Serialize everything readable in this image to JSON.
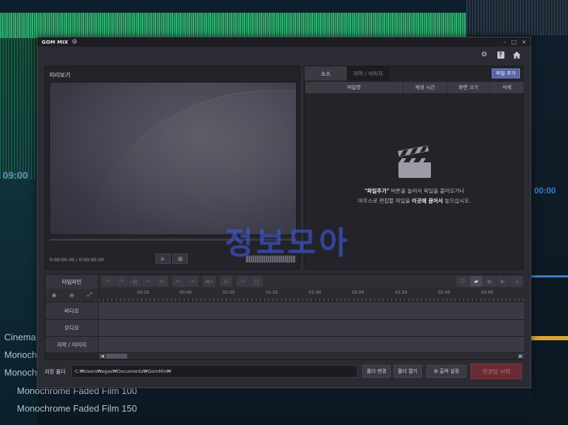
{
  "window": {
    "logo": "GOM MIX",
    "minimize": "–",
    "maximize": "□",
    "close": "×"
  },
  "preview": {
    "title": "미리보기",
    "time": "0:00:00.00 / 0:00:00.00"
  },
  "source": {
    "tabs": [
      "소스",
      "자막 / 이미지"
    ],
    "add_button": "파일 추가",
    "columns": [
      "파일명",
      "재생 시간",
      "화면 크기",
      "삭제"
    ],
    "empty_line1_bold": "\"파일추가\"",
    "empty_line1_rest": " 버튼을 눌러서 파일을 불러오거나",
    "empty_line2_pre": "마우스로 편집할 파일을 ",
    "empty_line2_bold": "이곳에 끌어서",
    "empty_line2_post": " 놓으십시오."
  },
  "timeline": {
    "label": "타임라인",
    "ticks": [
      "00:20",
      "00:40",
      "01:00",
      "01:20",
      "01:40",
      "02:00",
      "02:20",
      "02:40",
      "03:00"
    ],
    "tracks": [
      "비디오",
      "오디오",
      "자막 / 이미지"
    ]
  },
  "bottom": {
    "save_folder_label": "저장 폴더",
    "save_path": "C:₩Users₩egas₩Documents₩GomMix₩",
    "change_folder": "폴더 변경",
    "open_folder": "폴더 열기",
    "output_settings": "출력 설정",
    "start_encoding": "인코딩 시작"
  },
  "watermark": "정보모아",
  "background": {
    "time_left": "09:00",
    "time_right": "00:00",
    "list": [
      "Cinema",
      "Monochrome",
      "Monochrome",
      "Monochrome Faded Film 100",
      "Monochrome Faded Film 150"
    ]
  }
}
